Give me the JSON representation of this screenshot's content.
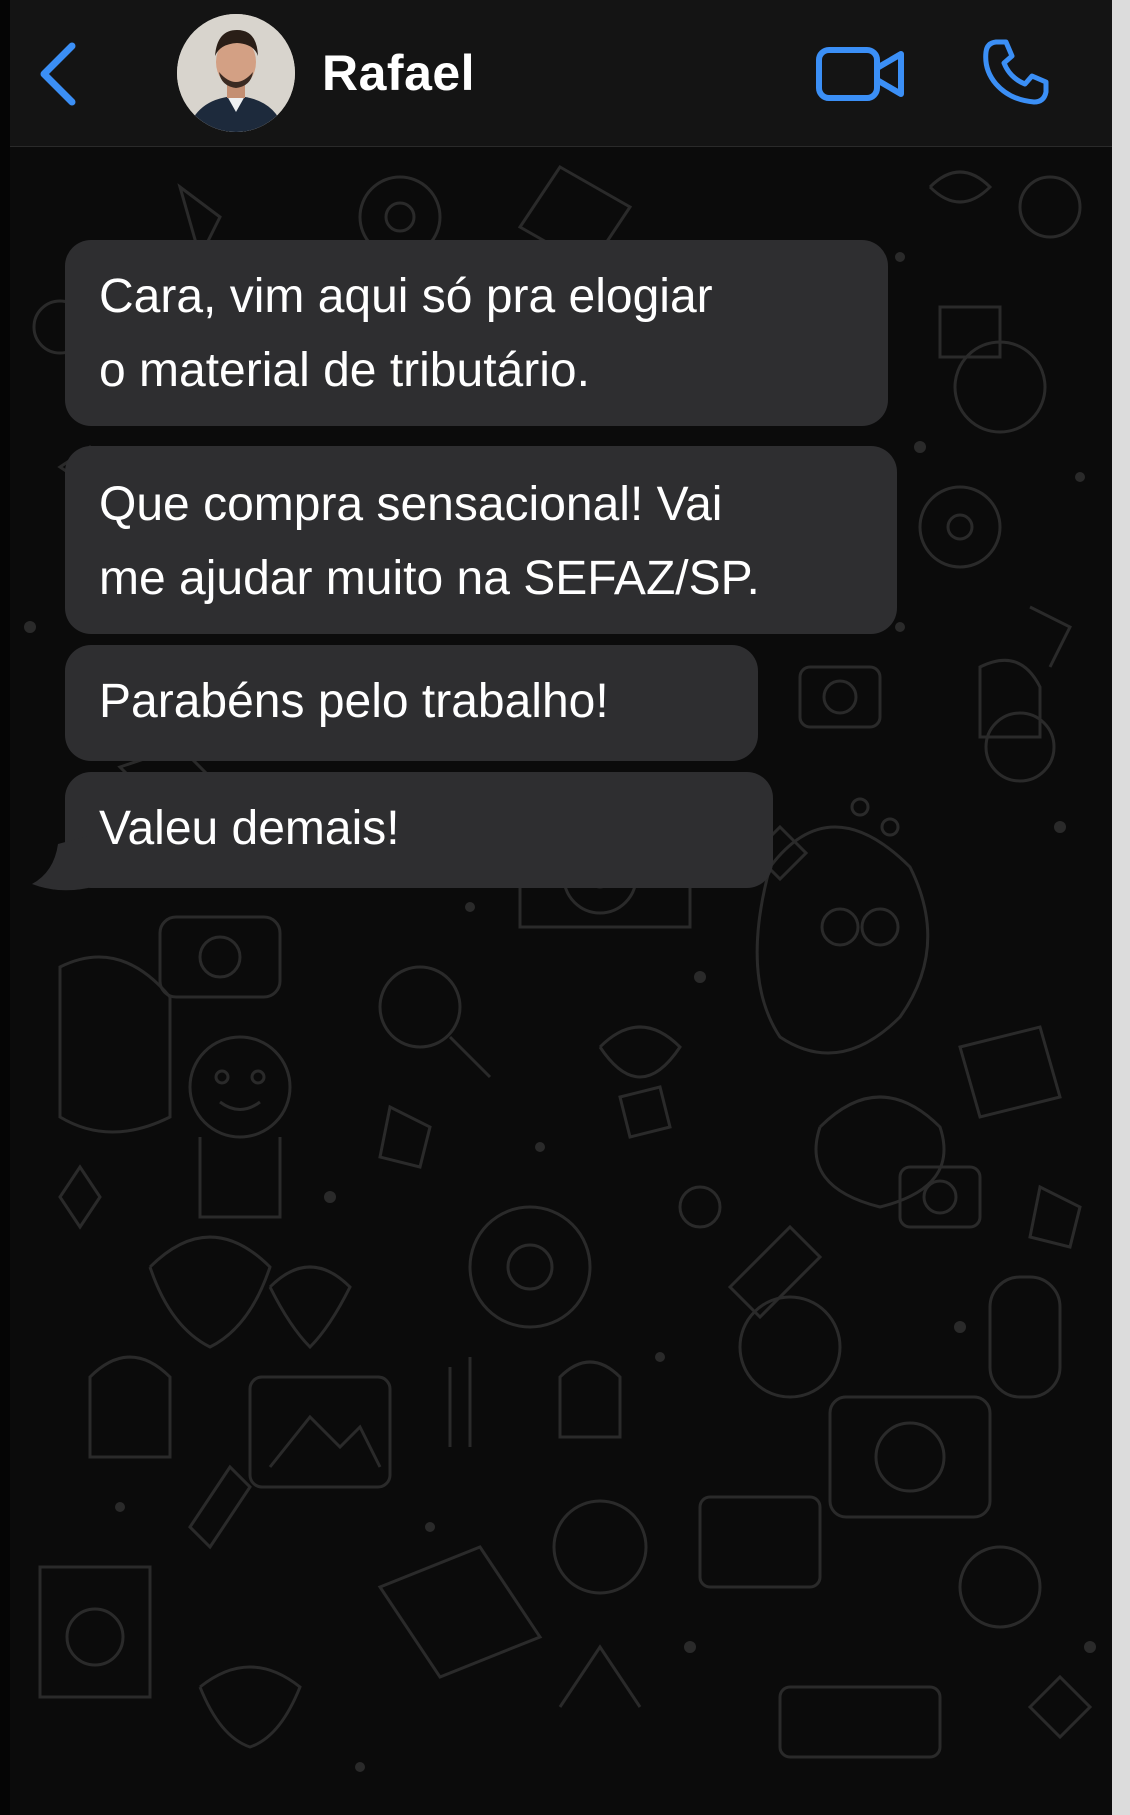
{
  "header": {
    "contact_name": "Rafael",
    "back_icon": "chevron-left-icon",
    "video_icon": "video-camera-icon",
    "call_icon": "phone-icon",
    "accent_color": "#3b8ff6"
  },
  "messages": [
    {
      "direction": "incoming",
      "text": "Cara, vim aqui só pra elogiar\no material de tributário."
    },
    {
      "direction": "incoming",
      "text": "Que compra sensacional! Vai\nme ajudar muito na SEFAZ/SP."
    },
    {
      "direction": "incoming",
      "text": "Parabéns pelo trabalho!"
    },
    {
      "direction": "incoming",
      "text": "Valeu demais!"
    }
  ],
  "colors": {
    "header_bg": "#141414",
    "wallpaper_bg": "#0b0b0b",
    "bubble_bg": "#2e2e30",
    "text": "#ffffff"
  }
}
